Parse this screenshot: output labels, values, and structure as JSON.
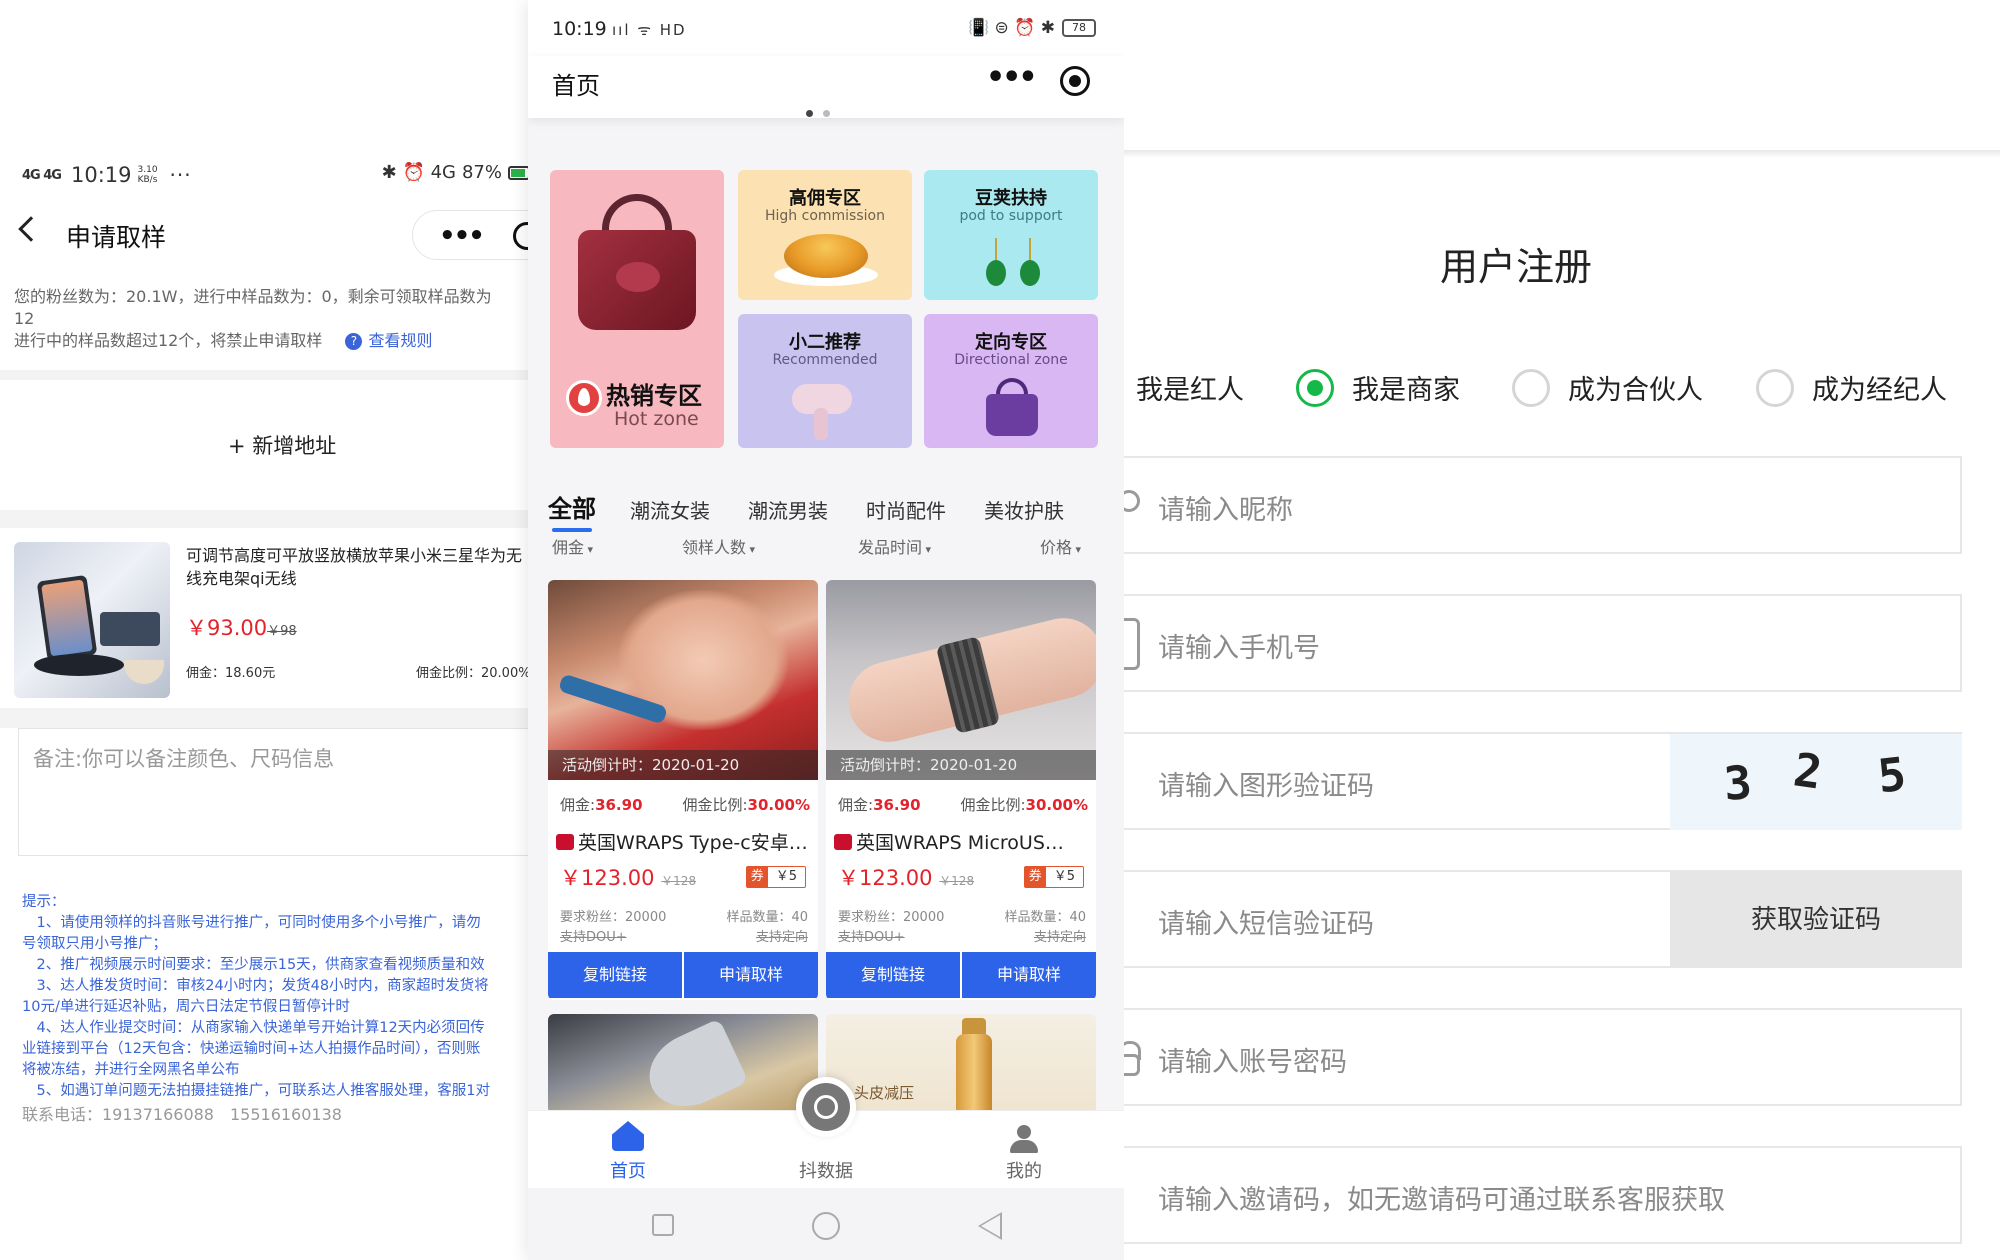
{
  "left": {
    "status": {
      "network": "4G 4G",
      "time": "10:19",
      "speed_top": "3.10",
      "speed_unit": "KB/s",
      "dots": "···",
      "right_icons": "✱ ⏰ 4G",
      "battery": "87%"
    },
    "nav": {
      "title": "申请取样",
      "more": "•••"
    },
    "info": {
      "line1": "您的粉丝数为：20.1W，进行中样品数为：0，剩余可领取样品数为",
      "line2": "12",
      "line3": "进行中的样品数超过12个，将禁止申请取样",
      "rules_icon": "?",
      "rules_link": "查看规则"
    },
    "add_address": "+ 新增地址",
    "product": {
      "title": "可调节高度可平放竖放横放苹果小米三星华为无线充电架qi无线",
      "price": "￥93.00",
      "orig_price": "￥98",
      "commission": "佣金：18.60元",
      "ratio": "佣金比例：20.00%"
    },
    "remark_placeholder": "备注:你可以备注颜色、尺码信息",
    "tips": [
      "提示：",
      "　1、请使用领样的抖音账号进行推广，可同时使用多个小号推广，请勿",
      "号领取只用小号推广；",
      "　2、推广视频展示时间要求：至少展示15天，供商家查看视频质量和效",
      "　3、达人推发货时间：审核24小时内；发货48小时内，商家超时发货将",
      "10元/单进行延迟补贴，周六日法定节假日暂停计时",
      "　4、达人作业提交时间：从商家输入快递单号开始计算12天内必须回传",
      "业链接到平台（12天包含：快递运输时间+达人拍摄作品时间），否则账",
      "将被冻结，并进行全网黑名单公布",
      "　5、如遇订单问题无法拍摄挂链推广，可联系达人推客服处理，客服1对"
    ],
    "contact": "联系电话：19137166088　15516160138"
  },
  "center": {
    "status": {
      "time": "10:19",
      "icons": "ııl ᯤ HD",
      "right_icons": "📳 ⊜ ⏰ ✱",
      "battery": "78"
    },
    "nav": {
      "title": "首页",
      "more": "•••"
    },
    "zones": {
      "hot": {
        "title": "热销专区",
        "sub": "Hot zone"
      },
      "high": {
        "title": "高佣专区",
        "sub": "High commission"
      },
      "pod": {
        "title": "豆荚扶持",
        "sub": "pod to support"
      },
      "rec": {
        "title": "小二推荐",
        "sub": "Recommended"
      },
      "dir": {
        "title": "定向专区",
        "sub": "Directional zone"
      }
    },
    "tabs": [
      "全部",
      "潮流女装",
      "潮流男装",
      "时尚配件",
      "美妆护肤"
    ],
    "sorts": [
      "佣金",
      "领样人数",
      "发品时间",
      "价格"
    ],
    "cards": [
      {
        "timer": "活动倒计时：2020-01-20",
        "comm_label": "佣金:",
        "comm": "36.90",
        "ratio_label": "佣金比例:",
        "ratio": "30.00%",
        "title": "英国WRAPS Type-c安卓…",
        "price": "￥123.00",
        "orig": "￥128",
        "coupon_q": "券",
        "coupon_v": "￥5",
        "req": "要求粉丝：20000",
        "samples": "样品数量：40",
        "dou": "支持DOU+",
        "dir": "支持定向",
        "btn_copy": "复制链接",
        "btn_apply": "申请取样"
      },
      {
        "timer": "活动倒计时：2020-01-20",
        "comm_label": "佣金:",
        "comm": "36.90",
        "ratio_label": "佣金比例:",
        "ratio": "30.00%",
        "title": "英国WRAPS MicroUS…",
        "price": "￥123.00",
        "orig": "￥128",
        "coupon_q": "券",
        "coupon_v": "￥5",
        "req": "要求粉丝：20000",
        "samples": "样品数量：40",
        "dou": "支持DOU+",
        "dir": "支持定向",
        "btn_copy": "复制链接",
        "btn_apply": "申请取样"
      }
    ],
    "card4_label": "头皮减压",
    "tabbar": [
      "首页",
      "抖数据",
      "我的"
    ]
  },
  "right": {
    "title": "用户注册",
    "roles": [
      "我是红人",
      "我是商家",
      "成为合伙人",
      "成为经纪人"
    ],
    "selected_role": "我是商家",
    "fields": {
      "nickname": "请输入昵称",
      "phone": "请输入手机号",
      "captcha": "请输入图形验证码",
      "sms": "请输入短信验证码",
      "password": "请输入账号密码",
      "invite": "请输入邀请码，如无邀请码可通过联系客服获取"
    },
    "captcha_code": [
      "3",
      "2",
      "5"
    ],
    "sms_button": "获取验证码"
  },
  "colors": {
    "accent_blue": "#2d63e8",
    "price_red": "#e3232c",
    "radio_green": "#15b94a"
  }
}
